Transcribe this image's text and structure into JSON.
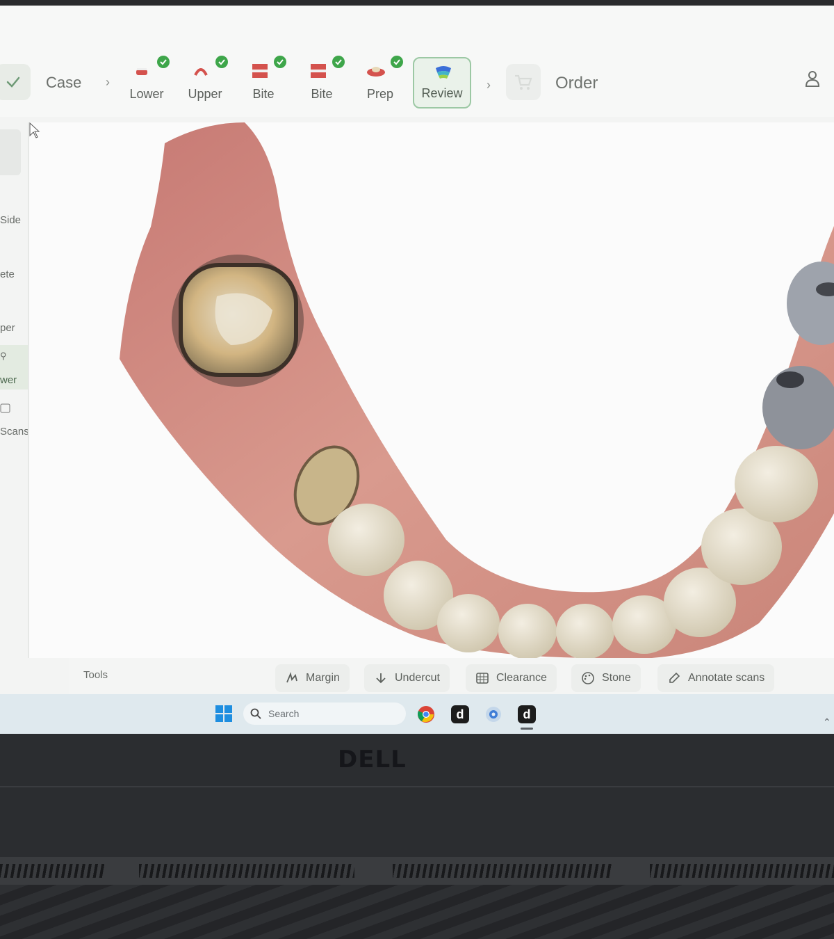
{
  "header": {
    "case_label": "Case",
    "steps": [
      {
        "label": "Lower",
        "done": true,
        "icon": "lower-jaw-icon"
      },
      {
        "label": "Upper",
        "done": true,
        "icon": "upper-jaw-icon"
      },
      {
        "label": "Bite",
        "done": true,
        "icon": "bite-icon"
      },
      {
        "label": "Bite",
        "done": true,
        "icon": "bite-icon"
      },
      {
        "label": "Prep",
        "done": true,
        "icon": "prep-icon"
      }
    ],
    "review_label": "Review",
    "order_label": "Order"
  },
  "sidebar": {
    "items": [
      {
        "label": "Side"
      },
      {
        "label": "ete"
      },
      {
        "label": "per"
      },
      {
        "label": "wer"
      },
      {
        "label": "Scans"
      }
    ]
  },
  "tools": {
    "label": "Tools",
    "buttons": [
      {
        "label": "Margin",
        "icon": "margin-icon"
      },
      {
        "label": "Undercut",
        "icon": "arrow-down-icon"
      },
      {
        "label": "Clearance",
        "icon": "clearance-icon"
      },
      {
        "label": "Stone",
        "icon": "palette-icon"
      },
      {
        "label": "Annotate scans",
        "icon": "annotate-icon"
      }
    ]
  },
  "taskbar": {
    "search_placeholder": "Search",
    "apps": [
      "chrome-icon",
      "d-app-icon",
      "browser-icon",
      "d-app-icon"
    ]
  },
  "hardware": {
    "brand": "DELL"
  },
  "colors": {
    "accent_green": "#3ea64a",
    "review_border": "#9cc8a4",
    "gum": "#d88e86"
  }
}
